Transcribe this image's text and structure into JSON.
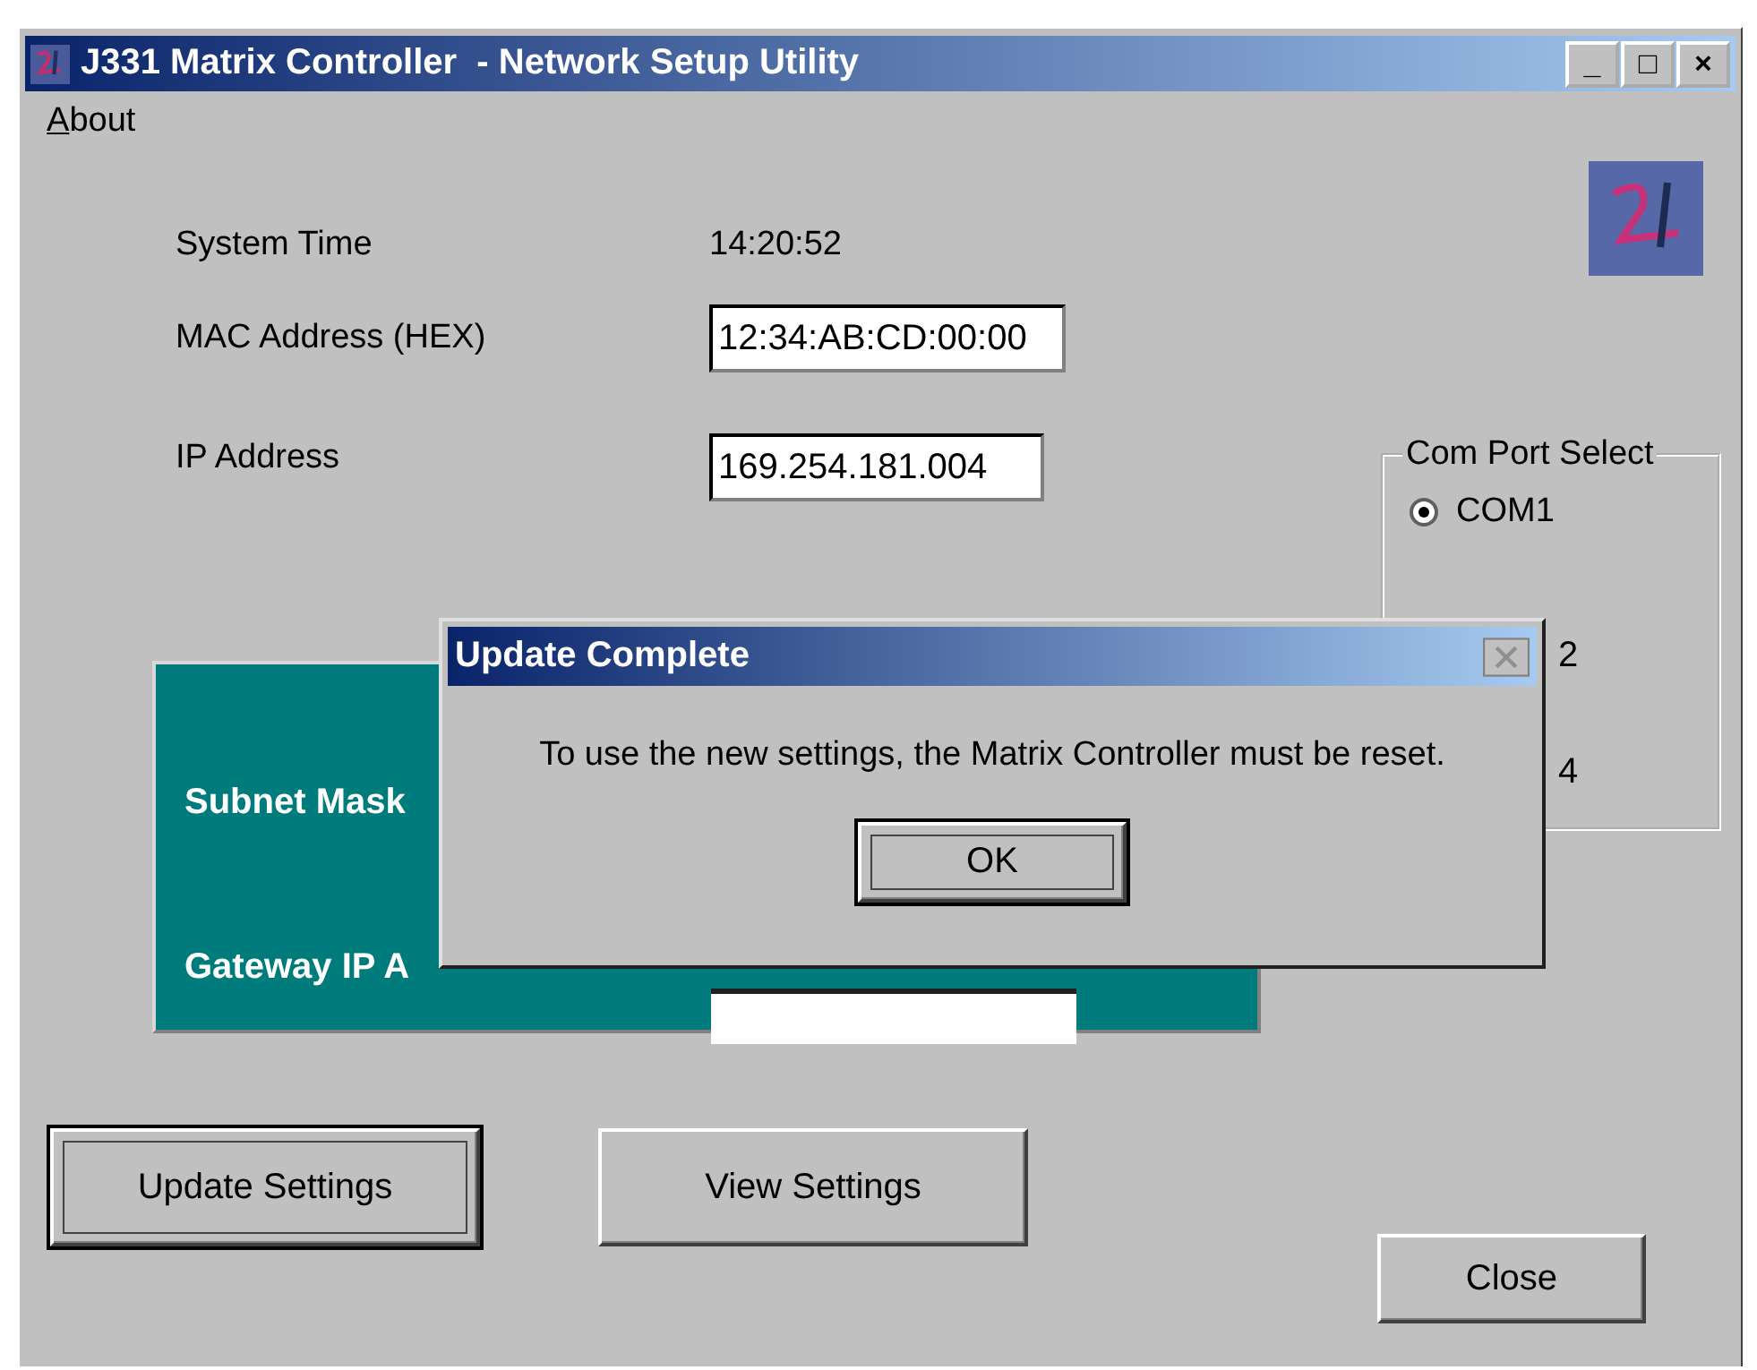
{
  "window": {
    "title": "J331 Matrix Controller  - Network Setup Utility",
    "controls": [
      "_",
      "□",
      "×"
    ]
  },
  "menu": [
    {
      "label": "About"
    }
  ],
  "fields": [
    {
      "kind": "readout",
      "label": "System Time",
      "value": "14:20:52"
    },
    {
      "kind": "input",
      "label": "MAC Address (HEX)",
      "value": "12:34:AB:CD:00:00"
    },
    {
      "kind": "input",
      "label": "IP Address",
      "value": "169.254.181.004"
    }
  ],
  "com_port_group": {
    "title": "Com Port Select",
    "ports": [
      {
        "label": "COM1",
        "selected": true
      }
    ],
    "obscured_labels": [
      "2",
      "4"
    ]
  },
  "network_panel": {
    "labels": [
      "Subnet Mask",
      "Gateway IP A"
    ]
  },
  "buttons": [
    {
      "label": "Update Settings",
      "default": true
    },
    {
      "label": "View Settings",
      "default": false
    }
  ],
  "close_button": {
    "label": "Close"
  },
  "dialog": {
    "title": "Update Complete",
    "message": "To use the new settings, the Matrix Controller must be reset.",
    "button": "OK"
  }
}
